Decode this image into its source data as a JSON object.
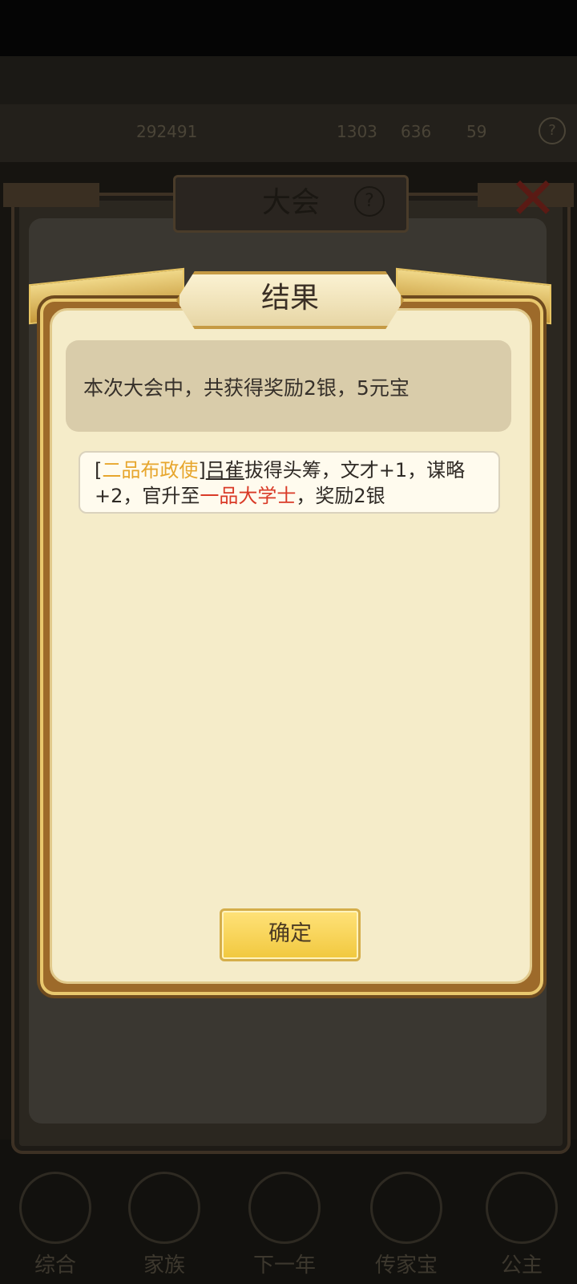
{
  "background": {
    "resource_bar": [
      "292491",
      "1303",
      "636",
      "59"
    ],
    "nav": [
      "综合",
      "家族",
      "下一年",
      "传家宝",
      "公主"
    ]
  },
  "outer_panel": {
    "title": "大会",
    "help_icon": "question-circle-icon",
    "close_icon": "close-x-icon"
  },
  "dialog": {
    "title": "结果",
    "summary": "本次大会中，共获得奖励2银，5元宝",
    "log": {
      "bracket_open": "[",
      "rank": "二品布政使",
      "bracket_close": "]",
      "name": "吕雈",
      "middle": "拔得头筹，文才+1，谋略+2，官升至",
      "promotion": "一品大学士",
      "tail": "，奖励2银"
    },
    "confirm_label": "确定"
  },
  "colors": {
    "rank": "#e7a62d",
    "promotion": "#d93a27",
    "button": "#f1c83e",
    "dialog_bg": "#f5ecc9"
  }
}
